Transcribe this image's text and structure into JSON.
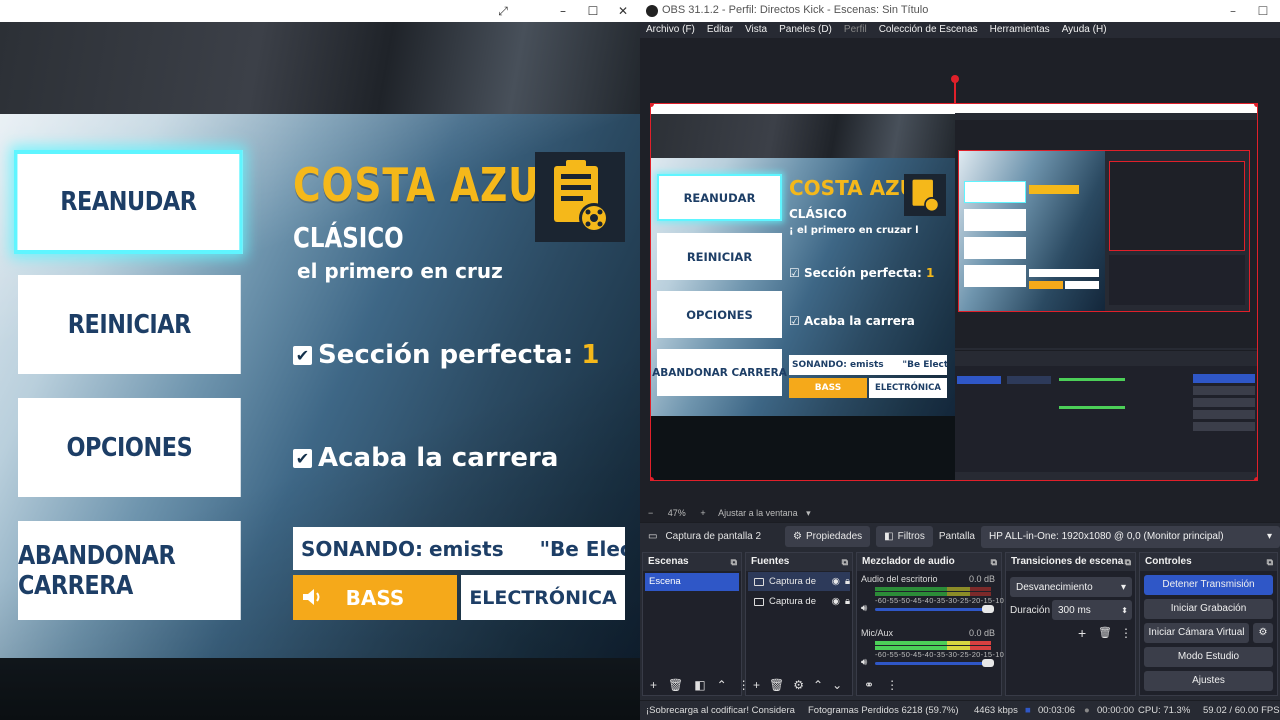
{
  "game": {
    "menu": [
      "REANUDAR",
      "REINICIAR",
      "OPCIONES",
      "ABANDONAR CARRERA"
    ],
    "track_title": "COSTA AZUL",
    "mode": "CLÁSICO",
    "description": "el primero en cruzar la",
    "objectives": [
      {
        "label": "Sección perfecta:",
        "value": "1"
      },
      {
        "label": "Acaba la carrera",
        "value": ""
      }
    ],
    "now_playing_label": "SONANDO:",
    "now_playing_artist": "emists",
    "now_playing_song": "\"Be Electric",
    "genre_bass": "BASS",
    "genre_active": "ELECTRÓNICA",
    "accent_color": "#f5b81a",
    "select_color": "#5ff5ff"
  },
  "obs": {
    "window_title": "OBS 31.1.2 - Perfil: Directos Kick - Escenas: Sin Título",
    "menu": [
      "Archivo (F)",
      "Editar",
      "Vista",
      "Paneles (D)",
      "Perfil",
      "Colección de Escenas",
      "Herramientas",
      "Ayuda (H)"
    ],
    "preview_mini": {
      "title": "COSTA AZUL",
      "mode": "CLÁSICO",
      "desc": "¡ el primero en cruzar l",
      "obj1": "Sección perfecta:",
      "obj1_val": "1",
      "obj2": "Acaba la carrera",
      "song": "SONANDO: emists",
      "song2": "\"Be Electric",
      "menu": [
        "REANUDAR",
        "REINICIAR",
        "OPCIONES",
        "ABANDONAR CARRERA"
      ],
      "bass": "BASS",
      "elec": "ELECTRÓNICA"
    },
    "zoom": "47%",
    "zoom_fit": "Ajustar a la ventana",
    "context": {
      "source": "Captura de pantalla 2",
      "properties": "Propiedades",
      "filters": "Filtros",
      "display_label": "Pantalla",
      "display_value": "HP ALL-in-One: 1920x1080 @ 0,0 (Monitor principal)"
    },
    "docks": {
      "scenes": {
        "title": "Escenas",
        "items": [
          "Escena"
        ]
      },
      "sources": {
        "title": "Fuentes",
        "items": [
          "Captura de",
          "Captura de"
        ]
      },
      "mixer": {
        "title": "Mezclador de audio",
        "channels": [
          {
            "name": "Audio del escritorio",
            "db": "0.0 dB"
          },
          {
            "name": "Mic/Aux",
            "db": "0.0 dB"
          }
        ],
        "scale": "-60-55-50-45-40-35-30-25-20-15-10 -5 0"
      },
      "transitions": {
        "title": "Transiciones de escena",
        "type": "Desvanecimiento",
        "duration_label": "Duración",
        "duration": "300 ms"
      },
      "controls": {
        "title": "Controles",
        "buttons": [
          "Detener Transmisión",
          "Iniciar Grabación",
          "Iniciar Cámara Virtual",
          "Modo Estudio",
          "Ajustes"
        ]
      }
    },
    "status": {
      "warning": "¡Sobrecarga al codificar! Considera baja",
      "dropped": "Fotogramas Perdidos 6218 (59.7%)",
      "bitrate": "4463 kbps",
      "stream_time": "00:03:06",
      "rec_time": "00:00:00",
      "cpu": "CPU: 71.3%",
      "fps": "59.02 / 60.00 FPS"
    }
  }
}
